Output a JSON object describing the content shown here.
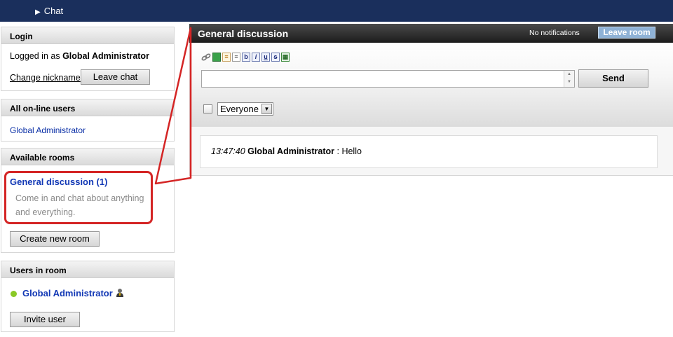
{
  "header": {
    "breadcrumb": "Chat"
  },
  "login": {
    "title": "Login",
    "logged_in_prefix": "Logged in as",
    "user": "Global Administrator",
    "change_nickname": "Change nickname",
    "leave_chat": "Leave chat"
  },
  "online": {
    "title": "All on-line users",
    "users": [
      "Global Administrator"
    ]
  },
  "rooms": {
    "title": "Available rooms",
    "items": [
      {
        "name": "General discussion (1)",
        "description": "Come in and chat about anything and everything."
      }
    ],
    "create_room": "Create new room"
  },
  "room_users": {
    "title": "Users in room",
    "users": [
      {
        "name": "Global Administrator",
        "status": "online"
      }
    ],
    "invite": "Invite user"
  },
  "main": {
    "room_title": "General discussion",
    "notifications": "No notifications",
    "leave_room": "Leave room",
    "send": "Send",
    "message_value": "",
    "recipient": "Everyone",
    "messages": [
      {
        "time": "13:47:40",
        "author": "Global Administrator",
        "separator": " : ",
        "text": "Hello"
      }
    ]
  },
  "colors": {
    "topbar": "#1a2f5c",
    "link": "#1238b5",
    "annotation": "#d42525",
    "online_dot": "#8ac926"
  }
}
